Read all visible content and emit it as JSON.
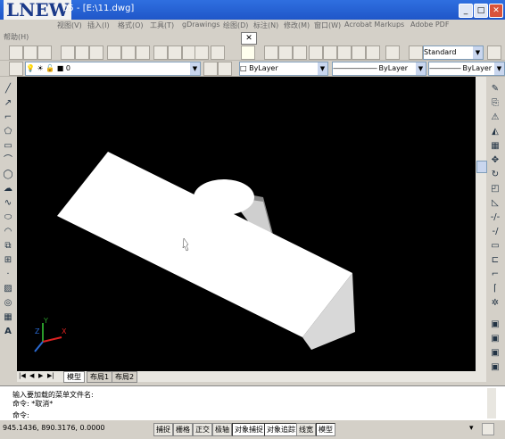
{
  "logo": "LNEW",
  "window": {
    "title": "05 - [E:\\11.dwg]",
    "min": "_",
    "max": "□",
    "close": "✕"
  },
  "menu": [
    "视图(V)",
    "插入(I)",
    "格式(O)",
    "工具(T)",
    "gDrawings",
    "绘图(D)",
    "标注(N)",
    "修改(M)",
    "窗口(W)",
    "Acrobat Markups",
    "Adobe PDF"
  ],
  "menu_help": "帮助(H)",
  "toolbar": {
    "style": "Standard",
    "close_x": "✕"
  },
  "layers": {
    "current": "0",
    "color": "ByLayer",
    "linetype": "ByLayer",
    "lineweight": "ByLayer"
  },
  "tabs": [
    "模型",
    "布局1",
    "布局2"
  ],
  "command": {
    "line1": "输入要加载的菜单文件名:",
    "line2": "命令:  *取消*",
    "line3": "命令:"
  },
  "status": {
    "coords": "945.1436, 890.3176, 0.0000",
    "buttons": [
      "捕捉",
      "栅格",
      "正交",
      "极轴",
      "对象捕捉",
      "对象追踪",
      "线宽",
      "模型"
    ]
  },
  "accent": "#2159c9"
}
